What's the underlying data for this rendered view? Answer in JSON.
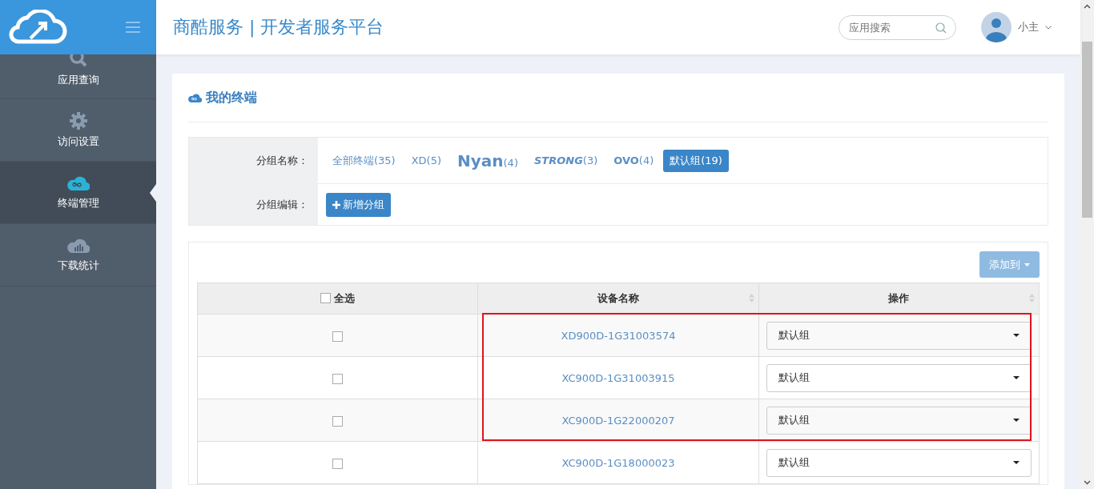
{
  "header": {
    "title": "商酷服务 | 开发者服务平台",
    "search": {
      "placeholder": "应用搜索"
    },
    "user": {
      "name": "小主"
    }
  },
  "sidebar": {
    "items": [
      {
        "label": "应用查询",
        "kind": "search",
        "selected": false
      },
      {
        "label": "访问设置",
        "kind": "settings",
        "selected": false
      },
      {
        "label": "终端管理",
        "kind": "terminals",
        "selected": true
      },
      {
        "label": "下载统计",
        "kind": "stats",
        "selected": false
      }
    ]
  },
  "card": {
    "title": "我的终端",
    "filter": {
      "group_label": "分组名称：",
      "groups": [
        {
          "name": "全部终端",
          "count": "(35)",
          "kind": "plain",
          "selected": false
        },
        {
          "name": "XD",
          "count": "(5)",
          "kind": "plain",
          "selected": false
        },
        {
          "name": "Nyan",
          "count": "(4)",
          "kind": "large",
          "selected": false
        },
        {
          "name": "STRONG",
          "count": "(3)",
          "kind": "italic",
          "selected": false
        },
        {
          "name": "OVO",
          "count": "(4)",
          "kind": "bold",
          "selected": false
        },
        {
          "name": "默认组",
          "count": "(19)",
          "kind": "plain",
          "selected": true
        }
      ],
      "edit_label": "分组编辑：",
      "add_button": "新增分组"
    },
    "add_to_button": {
      "label": "添加到",
      "disabled": true
    },
    "table": {
      "select_all": {
        "label": "全选",
        "checked": false
      },
      "columns": [
        "设备名称",
        "操作"
      ],
      "rows": [
        {
          "device": "XD900D-1G31003574",
          "group": "默认组",
          "checked": false,
          "highlighted": true
        },
        {
          "device": "XC900D-1G31003915",
          "group": "默认组",
          "checked": false,
          "highlighted": true
        },
        {
          "device": "XC900D-1G22000207",
          "group": "默认组",
          "checked": false,
          "highlighted": true
        },
        {
          "device": "XC900D-1G18000023",
          "group": "默认组",
          "checked": false,
          "highlighted": false
        }
      ]
    }
  }
}
